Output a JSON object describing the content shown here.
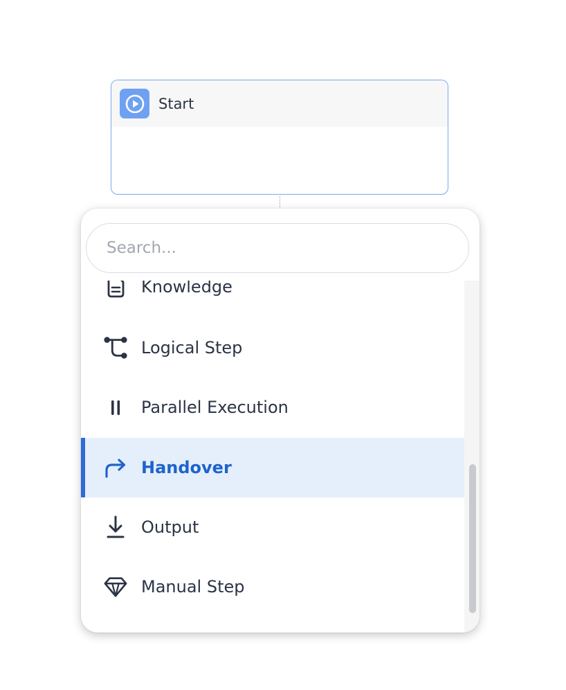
{
  "start_node": {
    "title": "Start"
  },
  "search": {
    "placeholder": "Search..."
  },
  "menu": {
    "items": [
      {
        "label": "Knowledge",
        "icon": "document-icon"
      },
      {
        "label": "Logical Step",
        "icon": "branch-icon"
      },
      {
        "label": "Parallel Execution",
        "icon": "pause-icon"
      },
      {
        "label": "Handover",
        "icon": "redirect-arrow-icon",
        "selected": true
      },
      {
        "label": "Output",
        "icon": "download-icon"
      },
      {
        "label": "Manual Step",
        "icon": "diamond-icon"
      }
    ]
  },
  "colors": {
    "accent": "#2e6ad8",
    "selected_bg": "#e5effb",
    "node_border": "#7aa7ee",
    "start_icon_bg": "#6fa1f2",
    "text": "#2b3445"
  }
}
